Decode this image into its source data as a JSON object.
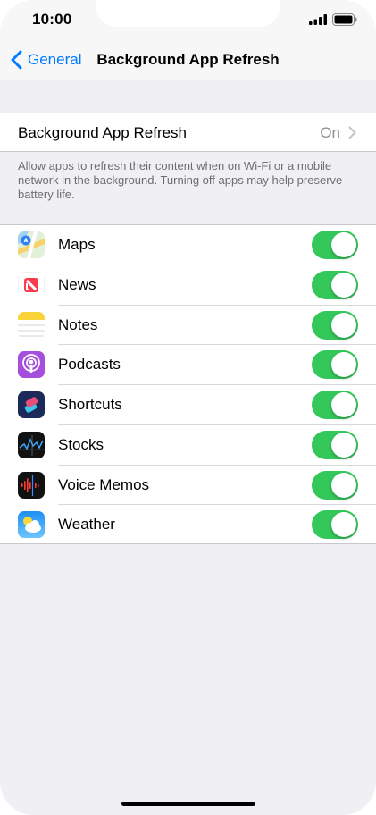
{
  "status_bar": {
    "time": "10:00"
  },
  "nav": {
    "back_label": "General",
    "title": "Background App Refresh"
  },
  "refresh_setting": {
    "label": "Background App Refresh",
    "value": "On"
  },
  "footer_note": "Allow apps to refresh their content when on Wi-Fi or a mobile network in the background. Turning off apps may help preserve battery life.",
  "apps": [
    {
      "name": "Maps",
      "icon": "maps-icon",
      "enabled": true
    },
    {
      "name": "News",
      "icon": "news-icon",
      "enabled": true
    },
    {
      "name": "Notes",
      "icon": "notes-icon",
      "enabled": true
    },
    {
      "name": "Podcasts",
      "icon": "podcasts-icon",
      "enabled": true
    },
    {
      "name": "Shortcuts",
      "icon": "shortcuts-icon",
      "enabled": true
    },
    {
      "name": "Stocks",
      "icon": "stocks-icon",
      "enabled": true
    },
    {
      "name": "Voice Memos",
      "icon": "voice-memos-icon",
      "enabled": true
    },
    {
      "name": "Weather",
      "icon": "weather-icon",
      "enabled": true
    }
  ],
  "colors": {
    "accent": "#007aff",
    "toggle_on": "#34c759",
    "background": "#efeff4"
  }
}
